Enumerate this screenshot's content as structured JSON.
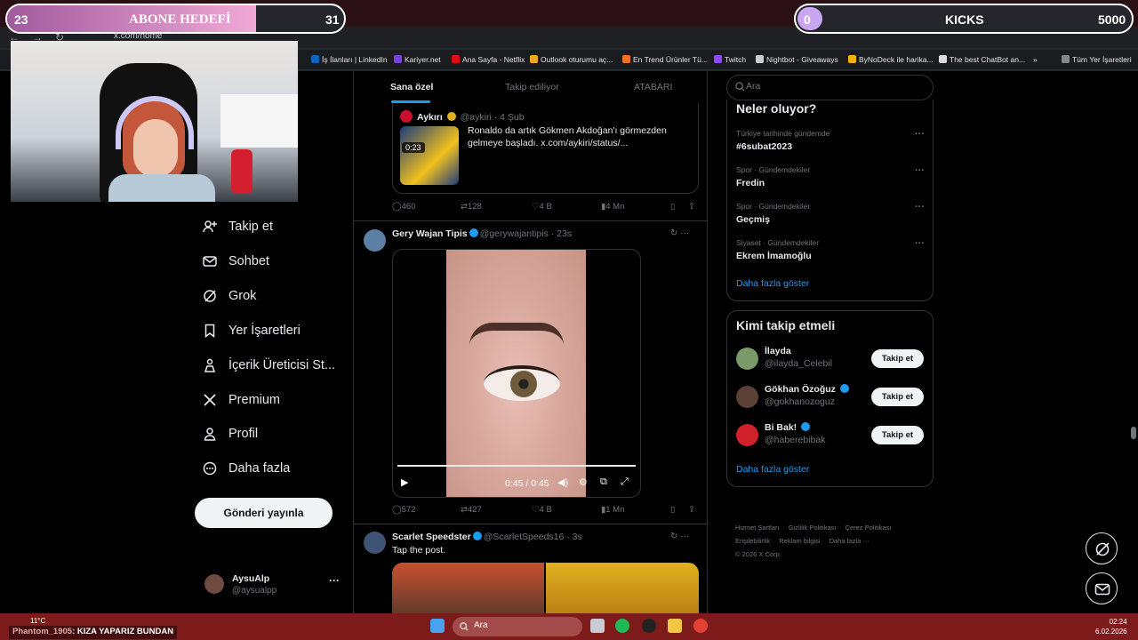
{
  "overlay": {
    "goal_left": {
      "current": "23",
      "title": "ABONE HEDEFİ",
      "target": "31",
      "progress": 0.74
    },
    "goal_right": {
      "current": "0",
      "title": "KICKS",
      "target": "5000",
      "progress": 0.0
    }
  },
  "browser": {
    "url": "x.com/home",
    "bookmarks": [
      "İş İlanları | LinkedIn",
      "Kariyer.net",
      "Ana Sayfa - Netflix",
      "Outlook oturumu aç...",
      "En Trend Ürünler Tü...",
      "Twitch",
      "Nightbot - Giveaways",
      "ByNoDeck ile harika...",
      "The best ChatBot an...",
      "Tüm Yer İşaretleri"
    ],
    "more_bookmarks": "»"
  },
  "sidebar": {
    "items": [
      {
        "label": "Takip et",
        "icon": "person-plus-icon"
      },
      {
        "label": "Sohbet",
        "icon": "envelope-icon"
      },
      {
        "label": "Grok",
        "icon": "grok-icon"
      },
      {
        "label": "Yer İşaretleri",
        "icon": "bookmark-icon"
      },
      {
        "label": "İçerik Üreticisi St...",
        "icon": "creator-studio-icon"
      },
      {
        "label": "Premium",
        "icon": "x-logo-icon"
      },
      {
        "label": "Profil",
        "icon": "person-icon"
      },
      {
        "label": "Daha fazla",
        "icon": "more-circle-icon"
      }
    ],
    "post_button": "Gönderi yayınla",
    "account": {
      "name": "AysuAlp",
      "handle": "@aysualpp",
      "more": "···"
    }
  },
  "timeline": {
    "tabs": [
      "Sana özel",
      "Takip ediliyor",
      "ATABARI"
    ],
    "quoted_post": {
      "name": "Aykırı",
      "handle": "@aykiri · 4 Şub",
      "text": "Ronaldo da artık Gökmen Akdoğan'ı görmezden gelmeye başladı.  x.com/aykiri/status/...",
      "video_duration": "0:23"
    },
    "post1_actions": {
      "replies": "460",
      "reposts": "128",
      "likes": "4 B",
      "views": "4 Mn"
    },
    "post2": {
      "name": "Gery Wajan Tipis",
      "meta": "@gerywajantipis · 23s",
      "video_time": "0:45 / 0:45",
      "video_progress": 1.0,
      "actions": {
        "replies": "572",
        "reposts": "427",
        "likes": "4 B",
        "views": "1 Mn"
      }
    },
    "post3": {
      "name": "Scarlet Speedster",
      "meta": "@ScarletSpeeds16 · 3s",
      "text": "Tap the post."
    }
  },
  "right": {
    "search_placeholder": "Ara",
    "trends_title": "Neler oluyor?",
    "trends": [
      {
        "context": "Türkiye tarihinde gündemde",
        "name": "#6subat2023"
      },
      {
        "context": "Spor · Gündemdekiler",
        "name": "Fredin"
      },
      {
        "context": "Spor · Gündemdekiler",
        "name": "Geçmiş"
      },
      {
        "context": "Siyaset · Gündemdekiler",
        "name": "Ekrem İmamoğlu"
      }
    ],
    "trends_more": "Daha fazla göster",
    "who_title": "Kimi takip etmeli",
    "who": [
      {
        "name": "İlayda",
        "handle": "@ilayda_Celebil",
        "button": "Takip et",
        "color": "#7a9a6a",
        "verified": false
      },
      {
        "name": "Gökhan Özoğuz",
        "handle": "@gokhanozoguz",
        "button": "Takip et",
        "color": "#5a4035",
        "verified": true
      },
      {
        "name": "Bi Bak!",
        "handle": "@haberebibak",
        "button": "Takip et",
        "color": "#d0202a",
        "verified": true
      }
    ],
    "who_more": "Daha fazla göster",
    "footer": [
      "Hizmet Şartları",
      "Gizlilik Politikası",
      "Çerez Politikası",
      "Erişilebilirlik",
      "Reklam bilgisi",
      "Daha fazla ···",
      "© 2026 X Corp."
    ]
  },
  "taskbar": {
    "chat_user": "Phantom_1905",
    "chat_message": ": KIZA YAPARIZ BUNDAN",
    "weather": "11°C",
    "search_placeholder": "Ara",
    "time": "02:24",
    "date": "6.02.2026"
  }
}
